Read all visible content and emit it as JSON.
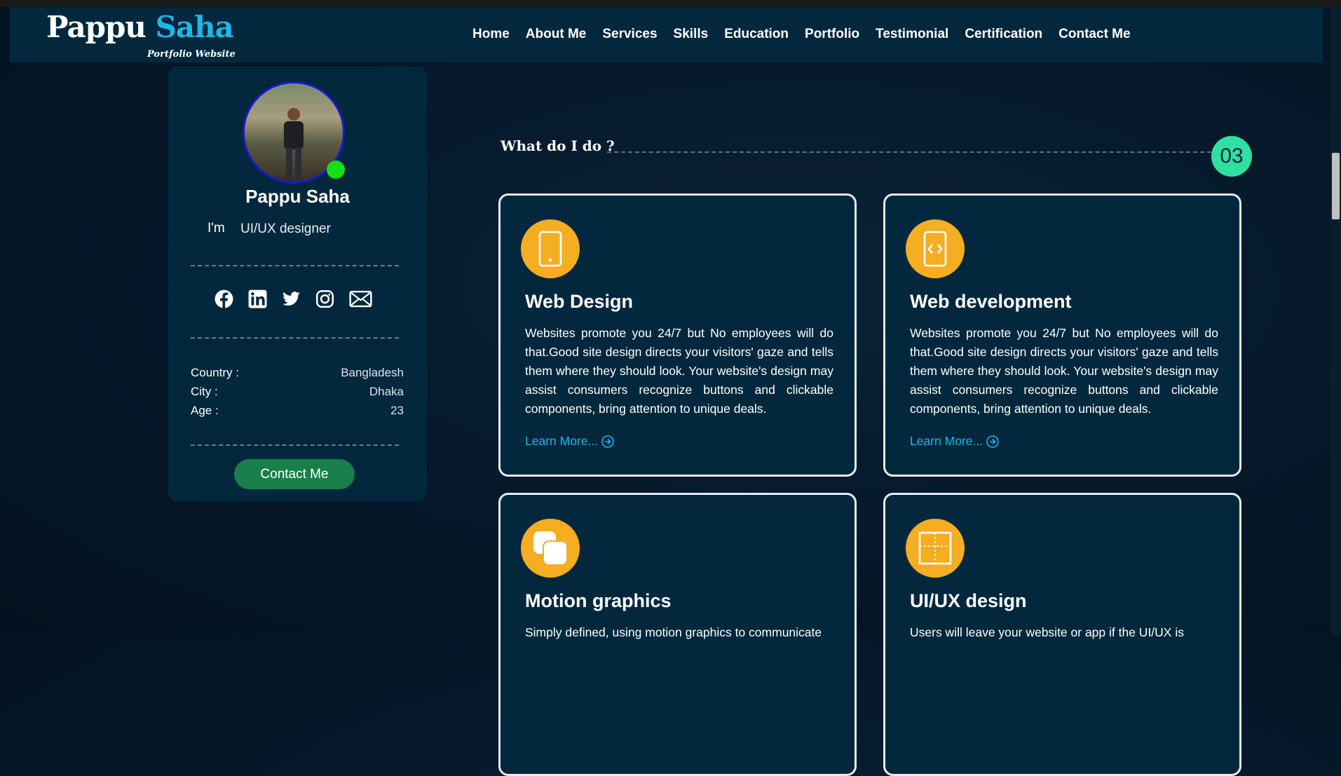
{
  "header": {
    "logo_first": "Pappu",
    "logo_last": "Saha",
    "logo_subtitle": "Portfolio Website",
    "nav": [
      "Home",
      "About Me",
      "Services",
      "Skills",
      "Education",
      "Portfolio",
      "Testimonial",
      "Certification",
      "Contact Me"
    ]
  },
  "profile": {
    "name": "Pappu Saha",
    "role_prefix": "I'm",
    "role": "UI/UX designer",
    "socials": [
      "facebook-icon",
      "linkedin-icon",
      "twitter-icon",
      "instagram-icon",
      "mail-icon"
    ],
    "info": [
      {
        "label": "Country :",
        "value": "Bangladesh"
      },
      {
        "label": "City :",
        "value": "Dhaka"
      },
      {
        "label": "Age :",
        "value": "23"
      }
    ],
    "contact_button": "Contact Me",
    "status_color": "#14e01a"
  },
  "services": {
    "title": "What do I do ?",
    "count": "03",
    "learn_more": "Learn More...",
    "cards": [
      {
        "icon": "mobile-icon",
        "title": "Web Design",
        "desc": "Websites promote you 24/7 but No employees will do that.Good site design directs your visitors' gaze and tells them where they should look. Your website's design may assist consumers recognize buttons and clickable components, bring attention to unique deals."
      },
      {
        "icon": "code-icon",
        "title": "Web development",
        "desc": "Websites promote you 24/7 but No employees will do that.Good site design directs your visitors' gaze and tells them where they should look. Your website's design may assist consumers recognize buttons and clickable components, bring attention to unique deals."
      },
      {
        "icon": "layers-icon",
        "title": "Motion graphics",
        "desc": "Simply defined, using motion graphics to communicate"
      },
      {
        "icon": "layout-icon",
        "title": "UI/UX design",
        "desc": "Users will leave your website or app if the UI/UX is"
      }
    ]
  },
  "colors": {
    "accent_blue": "#1fb6e6",
    "accent_orange": "#f5ad22",
    "accent_green": "#2fe0a2",
    "button_green": "#17804a",
    "panel": "#03283d"
  }
}
